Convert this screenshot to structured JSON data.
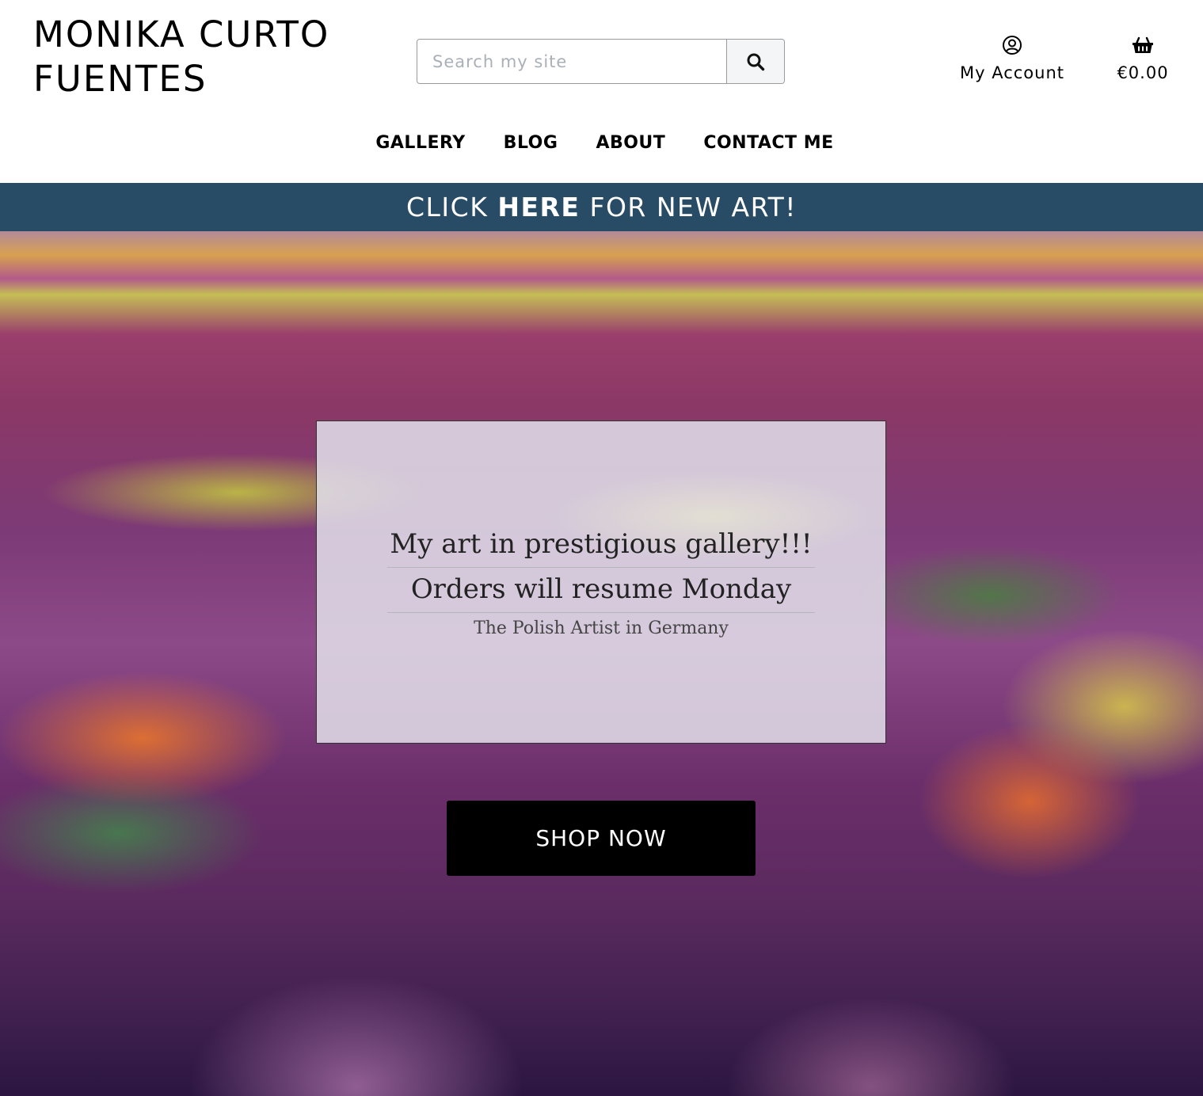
{
  "header": {
    "brand_line1": "MONIKA CURTO",
    "brand_line2": "FUENTES",
    "search": {
      "placeholder": "Search my site",
      "value": "",
      "button_icon": "search-icon"
    },
    "account": {
      "icon": "user-circle-icon",
      "label": "My Account"
    },
    "cart": {
      "icon": "basket-icon",
      "total": "€0.00"
    }
  },
  "nav": {
    "items": [
      {
        "label": "GALLERY"
      },
      {
        "label": "BLOG"
      },
      {
        "label": "ABOUT"
      },
      {
        "label": "CONTACT ME"
      }
    ]
  },
  "banner": {
    "prefix": "CLICK ",
    "emphasis": "HERE",
    "suffix": " FOR NEW ART!",
    "background_color": "#284b66"
  },
  "hero": {
    "headline": "My art in prestigious gallery!!!",
    "subheadline": "Orders will resume Monday",
    "tagline": "The Polish Artist in Germany",
    "cta_label": "SHOP NOW"
  }
}
